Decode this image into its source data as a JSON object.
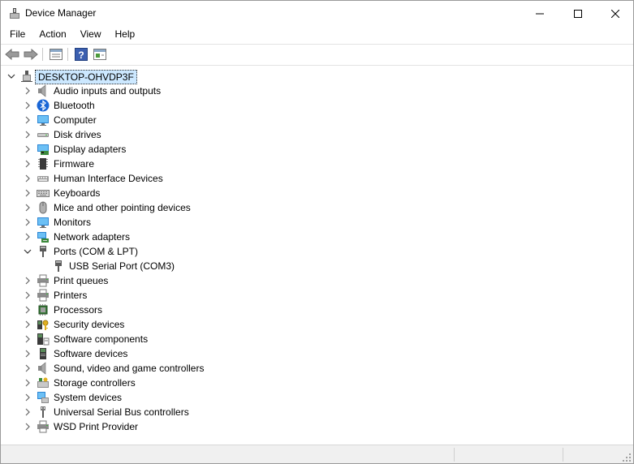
{
  "window": {
    "title": "Device Manager"
  },
  "menu": [
    "File",
    "Action",
    "View",
    "Help"
  ],
  "toolbar": {
    "buttons": [
      "back-icon",
      "forward-icon",
      "properties-icon",
      "help-icon",
      "update-driver-icon"
    ]
  },
  "tree": {
    "root": "DESKTOP-OHVDP3F",
    "items": [
      {
        "label": "Audio inputs and outputs",
        "icon": "speaker-icon"
      },
      {
        "label": "Bluetooth",
        "icon": "bluetooth-icon"
      },
      {
        "label": "Computer",
        "icon": "computer-icon"
      },
      {
        "label": "Disk drives",
        "icon": "disk-drive-icon"
      },
      {
        "label": "Display adapters",
        "icon": "display-adapter-icon"
      },
      {
        "label": "Firmware",
        "icon": "firmware-icon"
      },
      {
        "label": "Human Interface Devices",
        "icon": "hid-icon"
      },
      {
        "label": "Keyboards",
        "icon": "keyboard-icon"
      },
      {
        "label": "Mice and other pointing devices",
        "icon": "mouse-icon"
      },
      {
        "label": "Monitors",
        "icon": "monitor-icon"
      },
      {
        "label": "Network adapters",
        "icon": "network-adapter-icon"
      },
      {
        "label": "Ports (COM & LPT)",
        "icon": "port-icon",
        "expanded": true
      },
      {
        "label": "USB Serial Port (COM3)",
        "icon": "port-icon",
        "child": true
      },
      {
        "label": "Print queues",
        "icon": "printer-icon"
      },
      {
        "label": "Printers",
        "icon": "printer-icon"
      },
      {
        "label": "Processors",
        "icon": "processor-icon"
      },
      {
        "label": "Security devices",
        "icon": "security-key-icon"
      },
      {
        "label": "Software components",
        "icon": "software-component-icon"
      },
      {
        "label": "Software devices",
        "icon": "software-device-icon"
      },
      {
        "label": "Sound, video and game controllers",
        "icon": "speaker-icon"
      },
      {
        "label": "Storage controllers",
        "icon": "storage-controller-icon"
      },
      {
        "label": "System devices",
        "icon": "system-devices-icon"
      },
      {
        "label": "Universal Serial Bus controllers",
        "icon": "usb-icon"
      },
      {
        "label": "WSD Print Provider",
        "icon": "printer-icon"
      }
    ]
  },
  "colors": {
    "selection": "#cce8ff",
    "accent": "#0078d7",
    "statusbar": "#f0f0f0"
  }
}
